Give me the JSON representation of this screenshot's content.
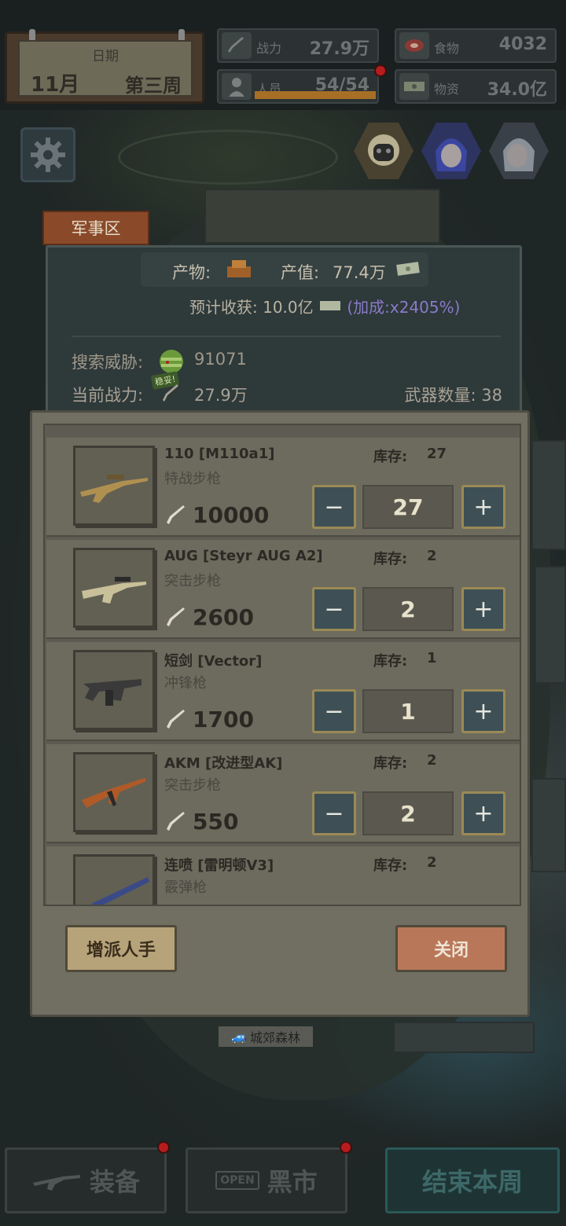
{
  "hud": {
    "date": {
      "title": "日期",
      "month": "11月",
      "week": "第三周"
    },
    "power": {
      "label": "战力",
      "value": "27.9万",
      "icon": "rifle-icon"
    },
    "food": {
      "value": "4032",
      "label": "食物",
      "icon": "meat-icon"
    },
    "personnel": {
      "label": "人员",
      "value": "54/54",
      "icon": "person-icon",
      "progress": 1.0
    },
    "supplies": {
      "label": "物资",
      "value": "34.0亿",
      "icon": "cash-icon"
    }
  },
  "characters": [
    {
      "name": "masked-robot",
      "color": "#c8b060"
    },
    {
      "name": "blue-hair-girl",
      "color": "#4a5ab0"
    },
    {
      "name": "silver-hair-girl",
      "color": "#a0a8b0"
    }
  ],
  "region": {
    "name": "军事区",
    "product_label": "产物:",
    "value_label": "产值:",
    "value": "77.4万",
    "harvest_label": "预计收获:",
    "harvest_value": "10.0亿",
    "bonus": "(加成:x2405%)",
    "threat_label": "搜索威胁:",
    "threat_value": "91071",
    "power_label": "当前战力:",
    "power_badge": "稳妥!",
    "power_value": "27.9万",
    "weapon_count_label": "武器数量: 38"
  },
  "weapons": [
    {
      "name": "110 [M110a1]",
      "type": "特战步枪",
      "stock_label": "库存:",
      "stock": "27",
      "power": "10000",
      "qty": "27",
      "gun_color": "#b09050"
    },
    {
      "name": "AUG [Steyr AUG A2]",
      "type": "突击步枪",
      "stock_label": "库存:",
      "stock": "2",
      "power": "2600",
      "qty": "2",
      "gun_color": "#c8c098"
    },
    {
      "name": "短剑 [Vector]",
      "type": "冲锋枪",
      "stock_label": "库存:",
      "stock": "1",
      "power": "1700",
      "qty": "1",
      "gun_color": "#3a3a3a"
    },
    {
      "name": "AKM [改进型AK]",
      "type": "突击步枪",
      "stock_label": "库存:",
      "stock": "2",
      "power": "550",
      "qty": "2",
      "gun_color": "#b05a28"
    },
    {
      "name": "连喷 [雷明顿V3]",
      "type": "霰弹枪",
      "stock_label": "库存:",
      "stock": "2",
      "power": "",
      "qty": "",
      "gun_color": "#3a4a88"
    }
  ],
  "buttons": {
    "minus": "−",
    "plus": "+",
    "assign": "增派人手",
    "close": "关闭"
  },
  "map_location": "城郊森林",
  "bottom": {
    "equip": "装备",
    "market": "黑市",
    "market_sign": "OPEN",
    "end_week": "结束本周"
  }
}
